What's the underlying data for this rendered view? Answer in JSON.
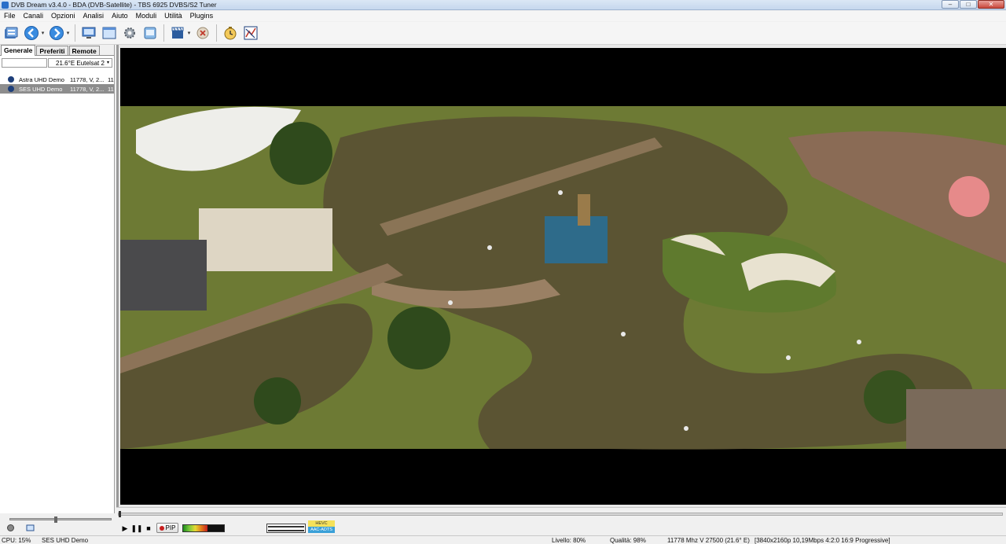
{
  "titlebar": {
    "title": "DVB Dream v3.4.0 - BDA (DVB-Satellite) - TBS 6925 DVBS/S2 Tuner",
    "minimize_glyph": "–",
    "maximize_glyph": "□",
    "close_glyph": "✕"
  },
  "menu": [
    "File",
    "Canali",
    "Opzioni",
    "Analisi",
    "Aiuto",
    "Moduli",
    "Utilità",
    "Plugins"
  ],
  "left_panel": {
    "tabs": [
      "Generale",
      "Preferiti",
      "Remote"
    ],
    "active_tab": 0,
    "satellite": "21.6°E Eutelsat 2",
    "channels": [
      {
        "name": "Astra UHD Demo",
        "info": "11778, V, 2...",
        "extra": "11",
        "selected": false
      },
      {
        "name": "SES UHD Demo",
        "info": "11778, V, 2...",
        "extra": "11",
        "selected": true
      }
    ]
  },
  "controls": {
    "pip_label": "PIP",
    "volume_percent": 60,
    "codec_video": "HEVC",
    "codec_audio": "AAC-ADTS"
  },
  "statusbar": {
    "cpu": "CPU: 15%",
    "channel": "SES UHD Demo",
    "level": "Livello: 80%",
    "quality": "Qualità: 98%",
    "frequency": "11778 Mhz  V  27500  (21.6° E)",
    "video_info": "[3840x2160p  10,19Mbps 4:2:0  16:9 Progressive]"
  }
}
